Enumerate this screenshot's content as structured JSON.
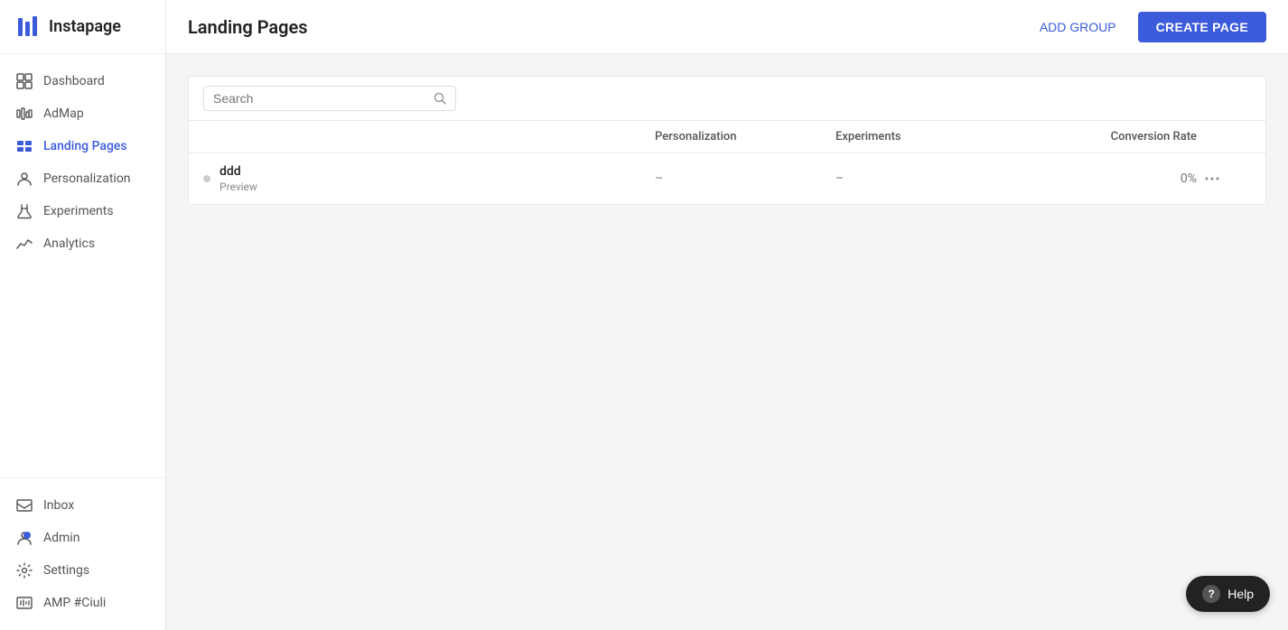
{
  "app": {
    "name": "Instapage"
  },
  "sidebar": {
    "nav_items": [
      {
        "id": "dashboard",
        "label": "Dashboard",
        "icon": "dashboard-icon",
        "active": false
      },
      {
        "id": "admap",
        "label": "AdMap",
        "icon": "admap-icon",
        "active": false
      },
      {
        "id": "landing-pages",
        "label": "Landing Pages",
        "icon": "landing-pages-icon",
        "active": true
      },
      {
        "id": "personalization",
        "label": "Personalization",
        "icon": "personalization-icon",
        "active": false
      },
      {
        "id": "experiments",
        "label": "Experiments",
        "icon": "experiments-icon",
        "active": false
      },
      {
        "id": "analytics",
        "label": "Analytics",
        "icon": "analytics-icon",
        "active": false
      }
    ],
    "bottom_items": [
      {
        "id": "inbox",
        "label": "Inbox",
        "icon": "inbox-icon",
        "has_dot": false
      },
      {
        "id": "admin",
        "label": "Admin",
        "icon": "admin-icon",
        "has_dot": true
      },
      {
        "id": "settings",
        "label": "Settings",
        "icon": "settings-icon",
        "has_dot": false
      },
      {
        "id": "amp",
        "label": "AMP #Ciuli",
        "icon": "amp-icon",
        "has_dot": false
      }
    ]
  },
  "header": {
    "title": "Landing Pages",
    "add_group_label": "ADD GROUP",
    "create_page_label": "CREATE PAGE"
  },
  "table": {
    "search_placeholder": "Search",
    "columns": [
      {
        "id": "name",
        "label": ""
      },
      {
        "id": "personalization",
        "label": "Personalization"
      },
      {
        "id": "experiments",
        "label": "Experiments"
      },
      {
        "id": "conversion_rate",
        "label": "Conversion Rate"
      },
      {
        "id": "actions",
        "label": ""
      }
    ],
    "rows": [
      {
        "name": "ddd",
        "sub": "Preview",
        "status": "inactive",
        "personalization": "–",
        "experiments": "–",
        "conversion_rate": "0%"
      }
    ]
  },
  "help": {
    "label": "Help"
  }
}
